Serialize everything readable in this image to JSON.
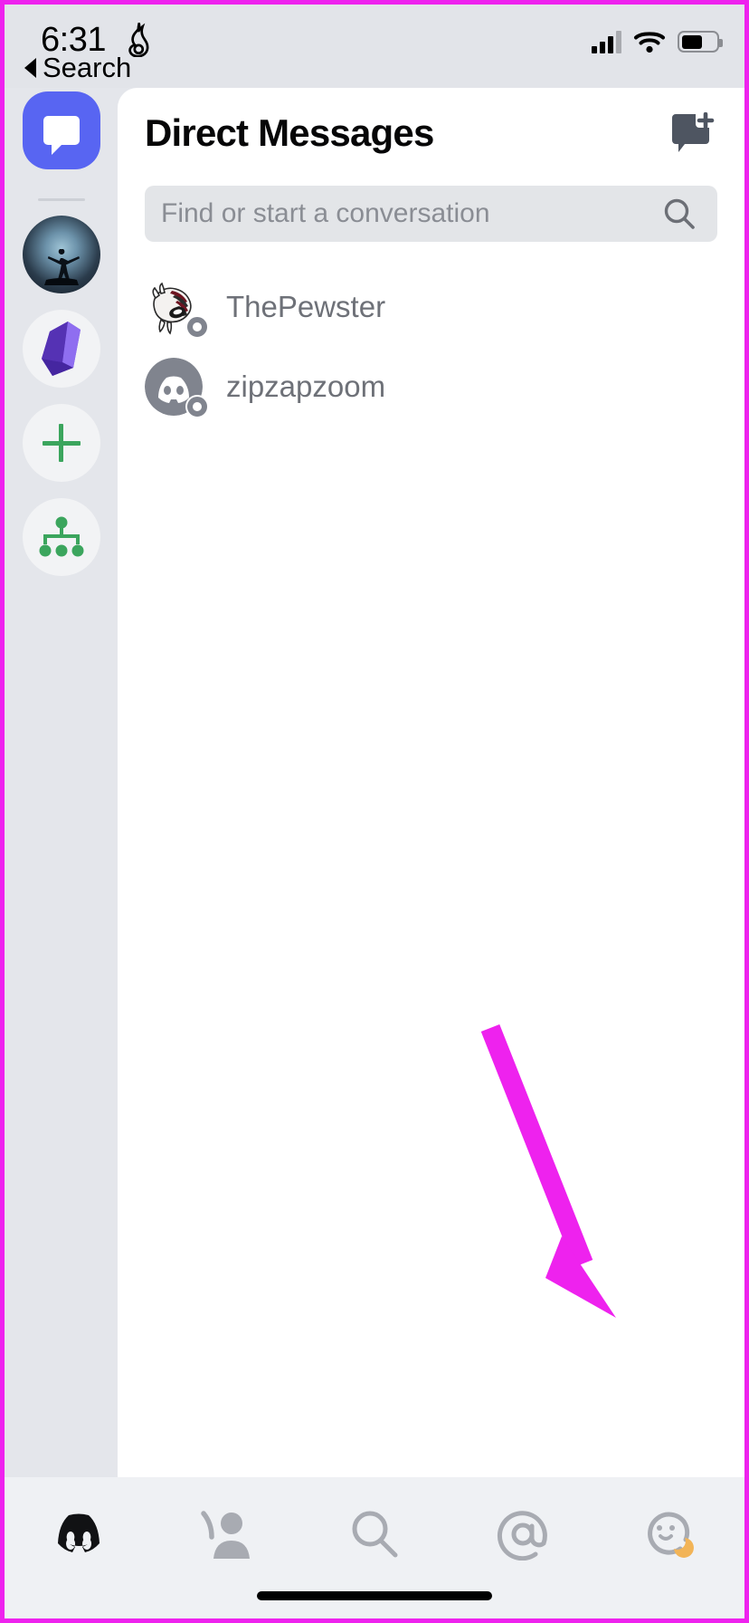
{
  "status_bar": {
    "time": "6:31",
    "flame_icon": "flame-icon",
    "signal_icon": "signal-bars-icon",
    "wifi_icon": "wifi-icon",
    "battery_icon": "battery-icon"
  },
  "back_nav": {
    "label": "Search",
    "icon": "back-triangle-icon"
  },
  "rail": {
    "dm_button": {
      "name": "direct-messages-button",
      "icon": "chat-bubble-icon",
      "color": "#5865f2"
    },
    "servers": [
      {
        "name": "server-moon-figure",
        "label": ""
      },
      {
        "name": "server-purple-gem",
        "label": ""
      }
    ],
    "add_server": {
      "name": "add-server-button",
      "icon": "plus-icon",
      "color": "#3ba55d"
    },
    "explore": {
      "name": "explore-servers-button",
      "icon": "explore-compass-icon",
      "color": "#3ba55d"
    }
  },
  "dm_panel": {
    "title": "Direct Messages",
    "new_dm_icon": "new-message-icon",
    "search": {
      "placeholder": "Find or start a conversation",
      "value": "",
      "icon": "search-icon"
    },
    "conversations": [
      {
        "name": "ThePewster",
        "avatar": "mask-avatar",
        "status": "offline"
      },
      {
        "name": "zipzapzoom",
        "avatar": "discord-clyde-avatar",
        "status": "offline"
      }
    ]
  },
  "annotation": {
    "arrow_color": "#ee22ee",
    "points_to": "profile-tab"
  },
  "tabbar": {
    "items": [
      {
        "name": "tab-servers",
        "icon": "discord-logo-icon",
        "active": true
      },
      {
        "name": "tab-friends",
        "icon": "friends-person-icon",
        "active": false
      },
      {
        "name": "tab-search",
        "icon": "search-icon",
        "active": false
      },
      {
        "name": "tab-mentions",
        "icon": "at-mention-icon",
        "active": false
      },
      {
        "name": "tab-profile",
        "icon": "profile-smiley-idle-icon",
        "active": false
      }
    ]
  },
  "home_indicator": "home-indicator"
}
